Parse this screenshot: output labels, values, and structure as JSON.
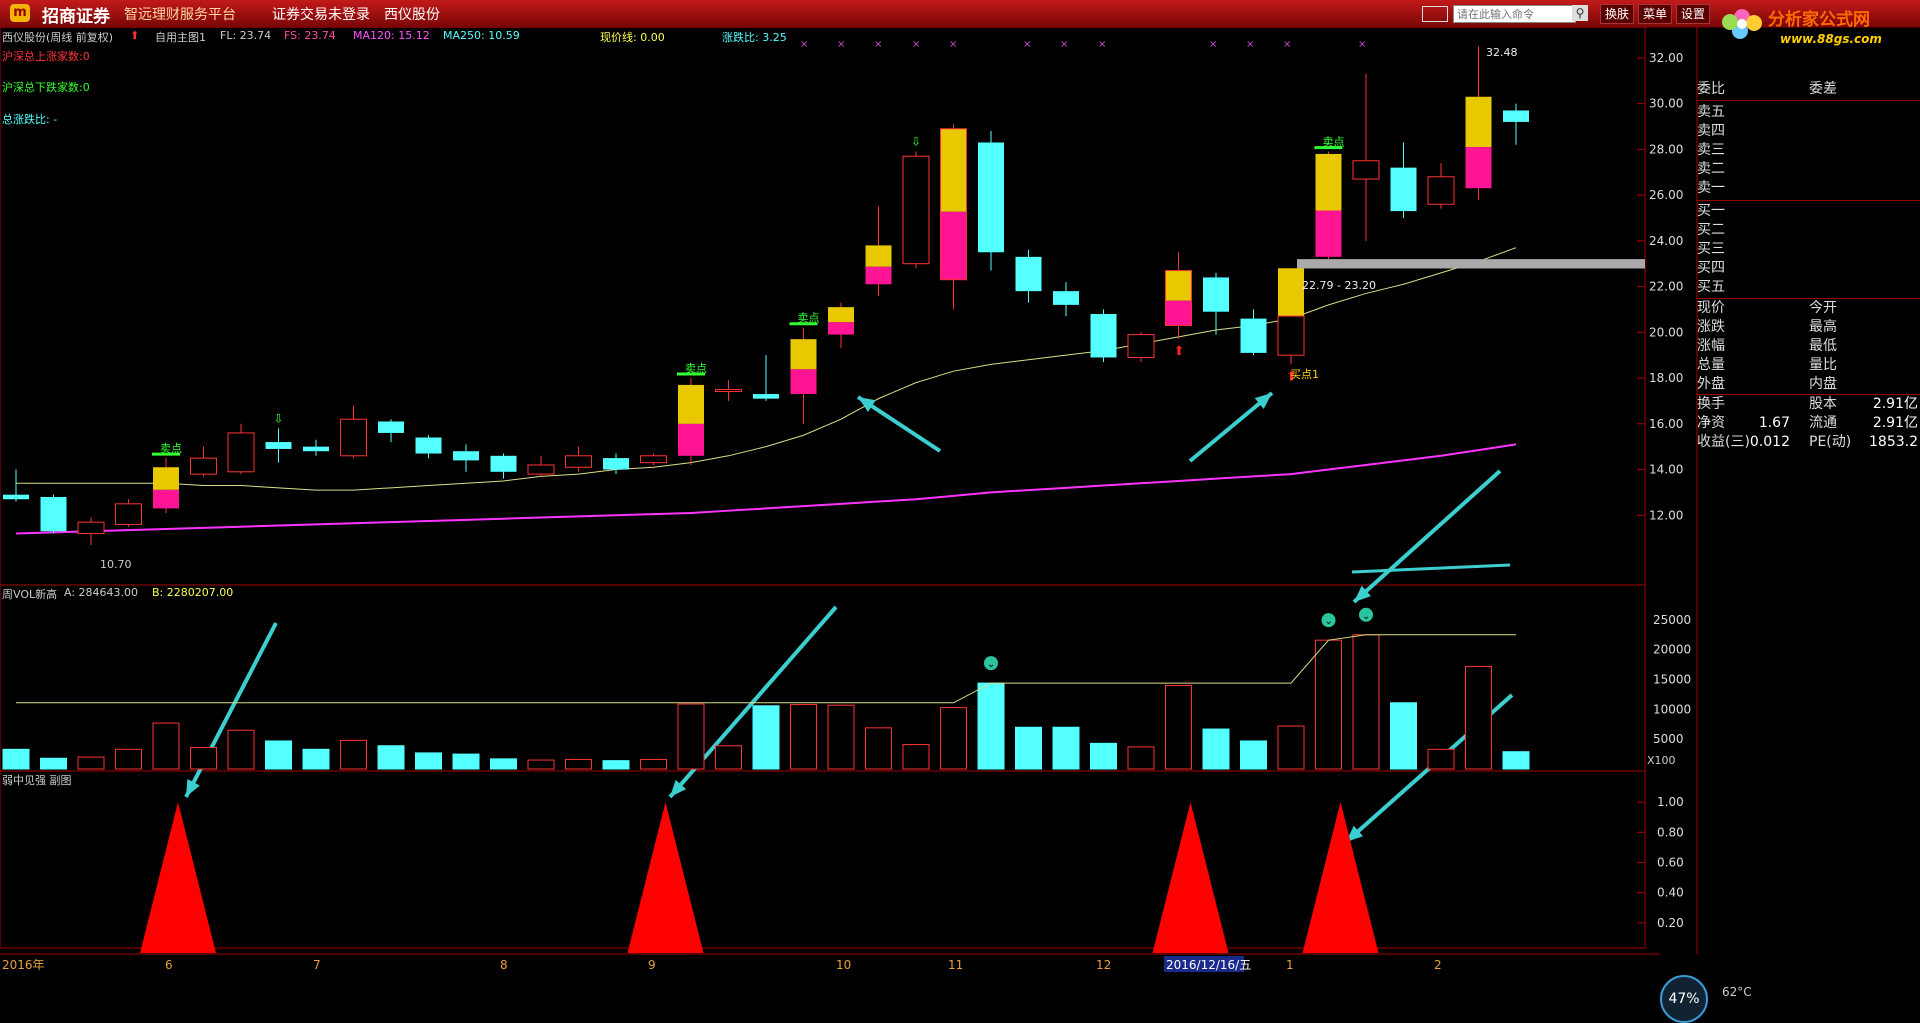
{
  "titlebar": {
    "brand": "招商证券",
    "slogan": "智远理财服务平台",
    "login_status": "证券交易未登录",
    "stock_name": "西仪股份",
    "command_placeholder": "请在此输入命令",
    "buttons": [
      "换肤",
      "菜单",
      "设置"
    ],
    "site_logo_text": "分析家公式网",
    "site_url": "www.88gs.com"
  },
  "main_info": {
    "stock_label": "西仪股份(周线 前复权)",
    "indicator": "自用主图1",
    "fl": "FL: 23.74",
    "fs": "FS: 23.74",
    "ma120": "MA120: 15.12",
    "ma250": "MA250: 10.59",
    "price_line": "现价线: 0.00",
    "ratio": "涨跌比: 3.25",
    "up_count": "沪深总上涨家数:0",
    "down_count": "沪深总下跌家数:0",
    "total_ratio": "总涨跌比: -",
    "band_label": "22.79 - 23.20",
    "low_label": "10.70",
    "high_label": "32.48",
    "buy_point": "买点1",
    "sell_point": "卖点"
  },
  "vol_info": {
    "title": "周VOL新高",
    "a": "A: 284643.00",
    "b": "B: 2280207.00",
    "unit": "X100"
  },
  "sub_info": {
    "title": "弱中见强 副图"
  },
  "time_axis": [
    "2016年",
    "6",
    "7",
    "8",
    "9",
    "10",
    "11",
    "12",
    "2016/12/16/五",
    "1",
    "2"
  ],
  "price_axis": [
    "32.00",
    "30.00",
    "28.00",
    "26.00",
    "24.00",
    "22.00",
    "20.00",
    "18.00",
    "16.00",
    "14.00",
    "12.00"
  ],
  "vol_axis": [
    "25000",
    "20000",
    "15000",
    "10000",
    "5000"
  ],
  "sub_axis": [
    "1.00",
    "0.80",
    "0.60",
    "0.40",
    "0.20"
  ],
  "colors": {
    "up": "#ff3333",
    "down": "#54ffff",
    "ma120": "#dddd88",
    "ma250": "#ff33ff",
    "gold": "#e8c800",
    "pink": "#ff1493"
  },
  "quote_panel": {
    "header": [
      "委比",
      "委差"
    ],
    "asks": [
      "卖五",
      "卖四",
      "卖三",
      "卖二",
      "卖一"
    ],
    "bids": [
      "买一",
      "买二",
      "买三",
      "买四",
      "买五"
    ],
    "stats": [
      [
        "现价",
        "今开"
      ],
      [
        "涨跌",
        "最高"
      ],
      [
        "涨幅",
        "最低"
      ],
      [
        "总量",
        "量比"
      ],
      [
        "外盘",
        "内盘"
      ]
    ],
    "fin": [
      [
        "换手",
        "",
        "股本",
        "2.91亿"
      ],
      [
        "净资",
        "1.67",
        "流通",
        "2.91亿"
      ],
      [
        "收益(三)",
        "0.012",
        "PE(动)",
        "1853.2"
      ]
    ]
  },
  "status": {
    "gauge": "47%",
    "temp": "62°C"
  },
  "chart_data": {
    "type": "candlestick",
    "weeks": [
      {
        "o": 12.9,
        "c": 12.7,
        "h": 14.0,
        "l": 12.6,
        "v": 3300
      },
      {
        "o": 12.8,
        "c": 11.3,
        "h": 12.9,
        "l": 11.2,
        "v": 1800
      },
      {
        "o": 11.2,
        "c": 11.7,
        "h": 11.9,
        "l": 10.7,
        "v": 2000
      },
      {
        "o": 11.6,
        "c": 12.5,
        "h": 12.7,
        "l": 11.5,
        "v": 3300
      },
      {
        "o": 12.3,
        "c": 14.1,
        "h": 14.5,
        "l": 12.1,
        "v": 7700,
        "mark": "gp"
      },
      {
        "o": 13.8,
        "c": 14.5,
        "h": 15.0,
        "l": 13.7,
        "v": 3600
      },
      {
        "o": 13.9,
        "c": 15.6,
        "h": 16.0,
        "l": 13.8,
        "v": 6500
      },
      {
        "o": 15.2,
        "c": 14.9,
        "h": 15.8,
        "l": 14.3,
        "v": 4700
      },
      {
        "o": 15.0,
        "c": 14.8,
        "h": 15.3,
        "l": 14.6,
        "v": 3300
      },
      {
        "o": 14.6,
        "c": 16.2,
        "h": 16.8,
        "l": 14.5,
        "v": 4800
      },
      {
        "o": 16.1,
        "c": 15.6,
        "h": 16.2,
        "l": 15.2,
        "v": 3900
      },
      {
        "o": 15.4,
        "c": 14.7,
        "h": 15.5,
        "l": 14.5,
        "v": 2700
      },
      {
        "o": 14.8,
        "c": 14.4,
        "h": 15.1,
        "l": 13.9,
        "v": 2500
      },
      {
        "o": 14.6,
        "c": 13.9,
        "h": 14.7,
        "l": 13.6,
        "v": 1700
      },
      {
        "o": 13.8,
        "c": 14.2,
        "h": 14.6,
        "l": 13.7,
        "v": 1500
      },
      {
        "o": 14.1,
        "c": 14.6,
        "h": 15.0,
        "l": 13.9,
        "v": 1600
      },
      {
        "o": 14.5,
        "c": 14.0,
        "h": 14.7,
        "l": 13.8,
        "v": 1400
      },
      {
        "o": 14.3,
        "c": 14.6,
        "h": 14.7,
        "l": 14.2,
        "v": 1600
      },
      {
        "o": 14.6,
        "c": 17.7,
        "h": 18.0,
        "l": 14.2,
        "v": 10900,
        "mark": "gp"
      },
      {
        "o": 17.5,
        "c": 17.5,
        "h": 17.9,
        "l": 17.0,
        "v": 3900
      },
      {
        "o": 17.3,
        "c": 17.1,
        "h": 19.0,
        "l": 17.0,
        "v": 10600
      },
      {
        "o": 17.3,
        "c": 19.7,
        "h": 20.2,
        "l": 16.0,
        "v": 10800,
        "mark": "gp"
      },
      {
        "o": 19.9,
        "c": 21.1,
        "h": 21.3,
        "l": 19.3,
        "v": 10700,
        "mark": "gp"
      },
      {
        "o": 22.1,
        "c": 23.8,
        "h": 25.5,
        "l": 21.6,
        "v": 6900,
        "mark": "gp"
      },
      {
        "o": 23.0,
        "c": 27.7,
        "h": 27.9,
        "l": 22.8,
        "v": 4100
      },
      {
        "o": 22.3,
        "c": 28.9,
        "h": 29.1,
        "l": 21.0,
        "v": 10300,
        "mark": "gpb"
      },
      {
        "o": 28.3,
        "c": 23.5,
        "h": 28.8,
        "l": 22.7,
        "v": 14400
      },
      {
        "o": 23.3,
        "c": 21.8,
        "h": 23.6,
        "l": 21.3,
        "v": 7000
      },
      {
        "o": 21.8,
        "c": 21.2,
        "h": 22.2,
        "l": 20.7,
        "v": 7000
      },
      {
        "o": 20.8,
        "c": 18.9,
        "h": 21.0,
        "l": 18.7,
        "v": 4300
      },
      {
        "o": 18.9,
        "c": 19.9,
        "h": 20.0,
        "l": 18.7,
        "v": 3700
      },
      {
        "o": 20.3,
        "c": 22.7,
        "h": 23.5,
        "l": 19.7,
        "v": 14000,
        "mark": "gpb"
      },
      {
        "o": 22.4,
        "c": 20.9,
        "h": 22.6,
        "l": 19.9,
        "v": 6700
      },
      {
        "o": 20.6,
        "c": 19.1,
        "h": 21.0,
        "l": 19.0,
        "v": 4700
      },
      {
        "o": 19.0,
        "c": 22.8,
        "h": 22.8,
        "l": 18.6,
        "v": 7200,
        "mark": "gold"
      },
      {
        "o": 23.3,
        "c": 27.8,
        "h": 27.9,
        "l": 23.2,
        "v": 21600,
        "mark": "gp"
      },
      {
        "o": 26.7,
        "c": 27.5,
        "h": 31.3,
        "l": 24.0,
        "v": 22500
      },
      {
        "o": 27.2,
        "c": 25.3,
        "h": 28.3,
        "l": 25.0,
        "v": 11100
      },
      {
        "o": 25.6,
        "c": 26.8,
        "h": 27.4,
        "l": 25.4,
        "v": 3300
      },
      {
        "o": 26.3,
        "c": 30.3,
        "h": 32.5,
        "l": 25.8,
        "v": 17200,
        "mark": "gp"
      },
      {
        "o": 29.7,
        "c": 29.2,
        "h": 30.0,
        "l": 28.2,
        "v": 2900
      }
    ],
    "ma120": [
      13.4,
      13.4,
      13.4,
      13.4,
      13.4,
      13.3,
      13.3,
      13.2,
      13.1,
      13.1,
      13.2,
      13.3,
      13.4,
      13.5,
      13.7,
      13.8,
      14.0,
      14.1,
      14.3,
      14.6,
      15.0,
      15.5,
      16.2,
      17.1,
      17.8,
      18.3,
      18.6,
      18.8,
      19.0,
      19.2,
      19.5,
      19.8,
      20.1,
      20.3,
      20.6,
      21.2,
      21.7,
      22.1,
      22.6,
      23.1,
      23.7
    ],
    "ma250": [
      11.2,
      11.25,
      11.3,
      11.35,
      11.4,
      11.45,
      11.5,
      11.55,
      11.6,
      11.65,
      11.7,
      11.75,
      11.8,
      11.85,
      11.9,
      11.95,
      12.0,
      12.05,
      12.1,
      12.2,
      12.3,
      12.4,
      12.5,
      12.6,
      12.7,
      12.85,
      13.0,
      13.1,
      13.2,
      13.3,
      13.4,
      13.5,
      13.6,
      13.7,
      13.8,
      14.0,
      14.2,
      14.4,
      14.6,
      14.85,
      15.1
    ],
    "vol_highline": [
      11100,
      11100,
      11100,
      11100,
      11100,
      11100,
      11100,
      11100,
      11100,
      11100,
      11100,
      11100,
      11100,
      11100,
      11100,
      11100,
      11100,
      11100,
      11100,
      11100,
      11100,
      11100,
      11100,
      11100,
      11100,
      11100,
      14400,
      14400,
      14400,
      14400,
      14400,
      14400,
      14400,
      14400,
      14400,
      21600,
      22500,
      22500,
      22500,
      22500,
      22500
    ],
    "vol_markers": [
      26,
      35,
      36
    ],
    "sub_peaks": [
      4,
      17,
      31,
      35
    ],
    "price_range": [
      10.0,
      33.0
    ],
    "vol_range": [
      0,
      28000
    ],
    "sub_range": [
      0,
      1.1
    ]
  }
}
